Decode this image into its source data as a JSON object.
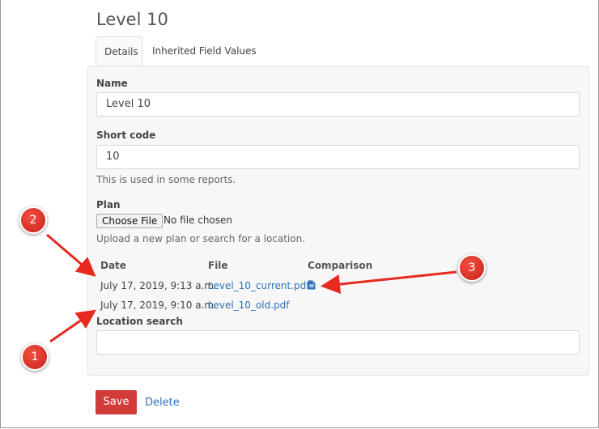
{
  "page": {
    "title": "Level 10"
  },
  "tabs": [
    {
      "label": "Details",
      "active": true
    },
    {
      "label": "Inherited Field Values",
      "active": false
    }
  ],
  "form": {
    "name": {
      "label": "Name",
      "value": "Level 10"
    },
    "short_code": {
      "label": "Short code",
      "value": "10",
      "help": "This is used in some reports."
    },
    "plan": {
      "label": "Plan",
      "choose_button": "Choose File",
      "file_status": "No file chosen",
      "help": "Upload a new plan or search for a location."
    },
    "plan_table": {
      "headers": [
        "Date",
        "File",
        "Comparison"
      ],
      "rows": [
        {
          "date": "July 17, 2019, 9:13 a.m.",
          "file": "Level_10_current.pdf",
          "comparison_icon": "pdf-document-icon"
        },
        {
          "date": "July 17, 2019, 9:10 a.m.",
          "file": "Level_10_old.pdf"
        }
      ]
    },
    "location_search": {
      "label": "Location search",
      "value": ""
    }
  },
  "actions": {
    "save": "Save",
    "delete": "Delete"
  },
  "annotations": [
    "1",
    "2",
    "3"
  ],
  "colors": {
    "accent_red": "#d33a3a",
    "link_blue": "#2f72b8",
    "annotation_red": "#e8291f"
  }
}
